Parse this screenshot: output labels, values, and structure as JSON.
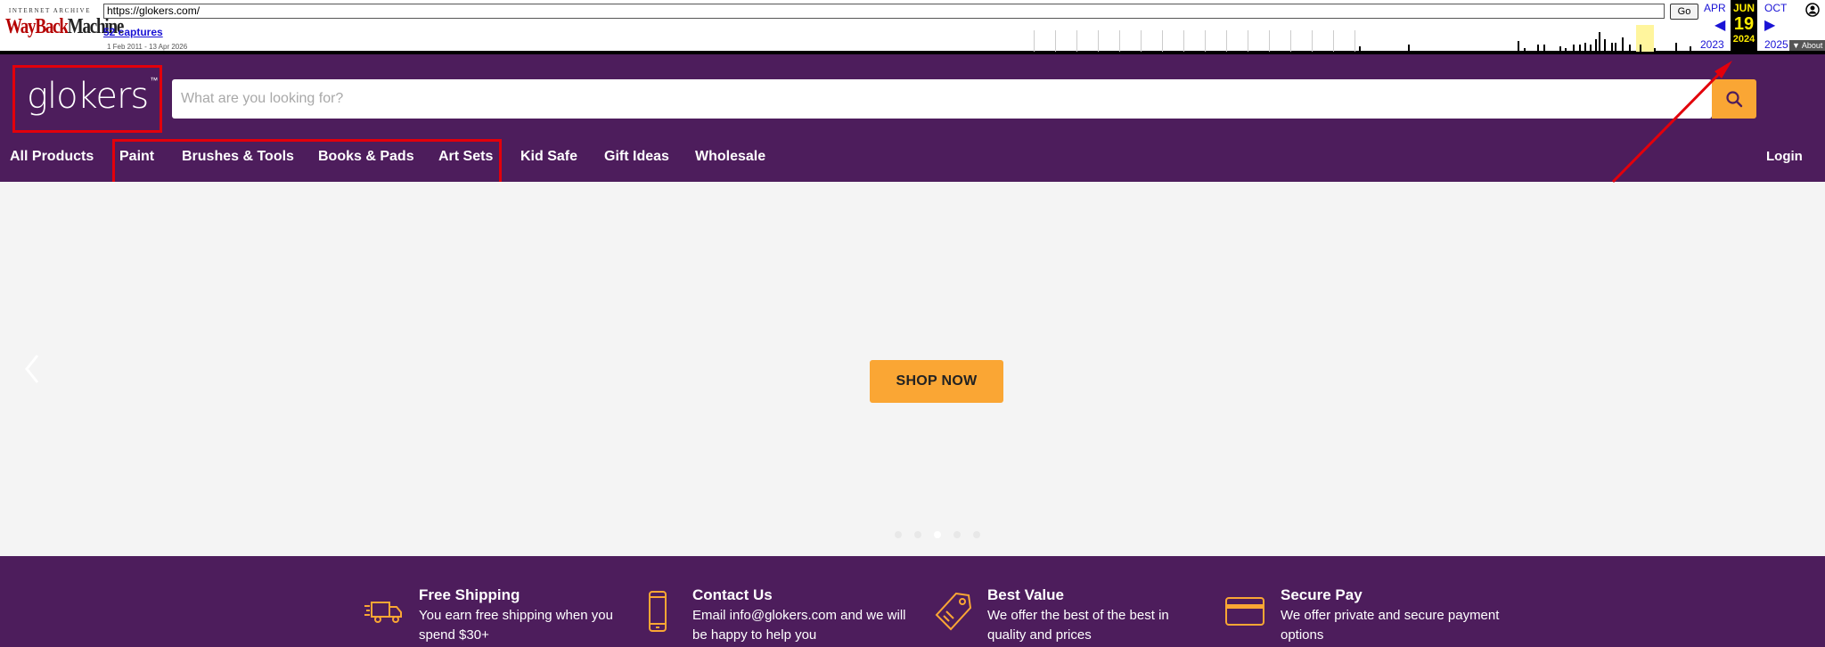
{
  "wayback": {
    "logo_top": "INTERNET ARCHIVE",
    "logo_way": "WayBack",
    "logo_machine": "Machine",
    "url": "https://glokers.com/",
    "go_label": "Go",
    "captures_label": "52 captures",
    "date_range": "1 Feb 2011 - 13 Apr 2026",
    "prev_month": "APR",
    "cur_month": "JUN",
    "next_month": "OCT",
    "cur_day": "19",
    "prev_year": "2023",
    "cur_year": "2024",
    "next_year": "2025",
    "about_label": "▼ About"
  },
  "header": {
    "logo_text": "glokers",
    "logo_tm": "™",
    "search_placeholder": "What are you looking for?"
  },
  "nav": {
    "items": [
      "All Products",
      "Paint",
      "Brushes & Tools",
      "Books & Pads",
      "Art Sets",
      "Kid Safe",
      "Gift Ideas",
      "Wholesale"
    ],
    "login": "Login"
  },
  "hero": {
    "cta": "SHOP NOW",
    "slide_count": 5,
    "active_slide": 2
  },
  "features": [
    {
      "icon": "truck-icon",
      "title": "Free Shipping",
      "text": "You earn free shipping when you spend $30+"
    },
    {
      "icon": "phone-icon",
      "title": "Contact Us",
      "text": "Email info@glokers.com and we will be happy to help you"
    },
    {
      "icon": "tag-icon",
      "title": "Best Value",
      "text": "We offer the best of the best in quality and prices"
    },
    {
      "icon": "card-icon",
      "title": "Secure Pay",
      "text": "We offer private and secure payment options"
    }
  ],
  "colors": {
    "brand_purple": "#4d1d5c",
    "accent_orange": "#faa634",
    "annotation_red": "#e3000b"
  }
}
